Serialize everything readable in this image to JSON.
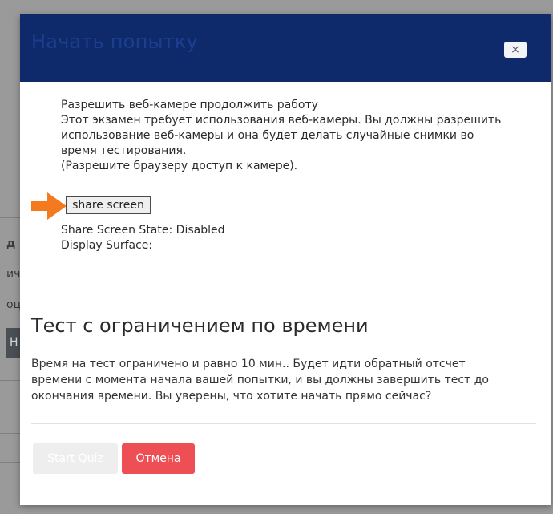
{
  "background": {
    "fragments": [
      "д",
      "ич",
      "оц",
      "Н"
    ]
  },
  "modal": {
    "title": "Начать попытку",
    "close_label": "×",
    "webcam": {
      "lines": [
        "Разрешить веб-камере продолжить работу",
        "Этот экзамен требует использования веб-камеры. Вы должны разрешить",
        "использование веб-камеры и она будет делать случайные снимки во",
        "время тестирования.",
        "(Разрешите браузеру доступ к камере)."
      ]
    },
    "share_button_label": "share screen",
    "share_state": "Share Screen State: Disabled",
    "display_surface": "Display Surface:",
    "section_title": "Тест с ограничением по времени",
    "description_lines": [
      "Время на тест ограничено и равно 10 мин.. Будет идти обратный отсчет",
      "времени с момента начала вашей попытки, и вы должны завершить тест до",
      "окончания времени. Вы уверены, что хотите начать прямо сейчас?"
    ],
    "start_button_label": "Start Quiz",
    "cancel_button_label": "Отмена"
  },
  "colors": {
    "header_bg": "#0f2a6b",
    "title_text": "#1a3f8f",
    "cancel_bg": "#ee4f54",
    "start_bg_disabled": "#eeeeee",
    "arrow": "#f47a20"
  },
  "icons": {
    "pointer": "arrow-right-icon",
    "close": "close-icon"
  }
}
